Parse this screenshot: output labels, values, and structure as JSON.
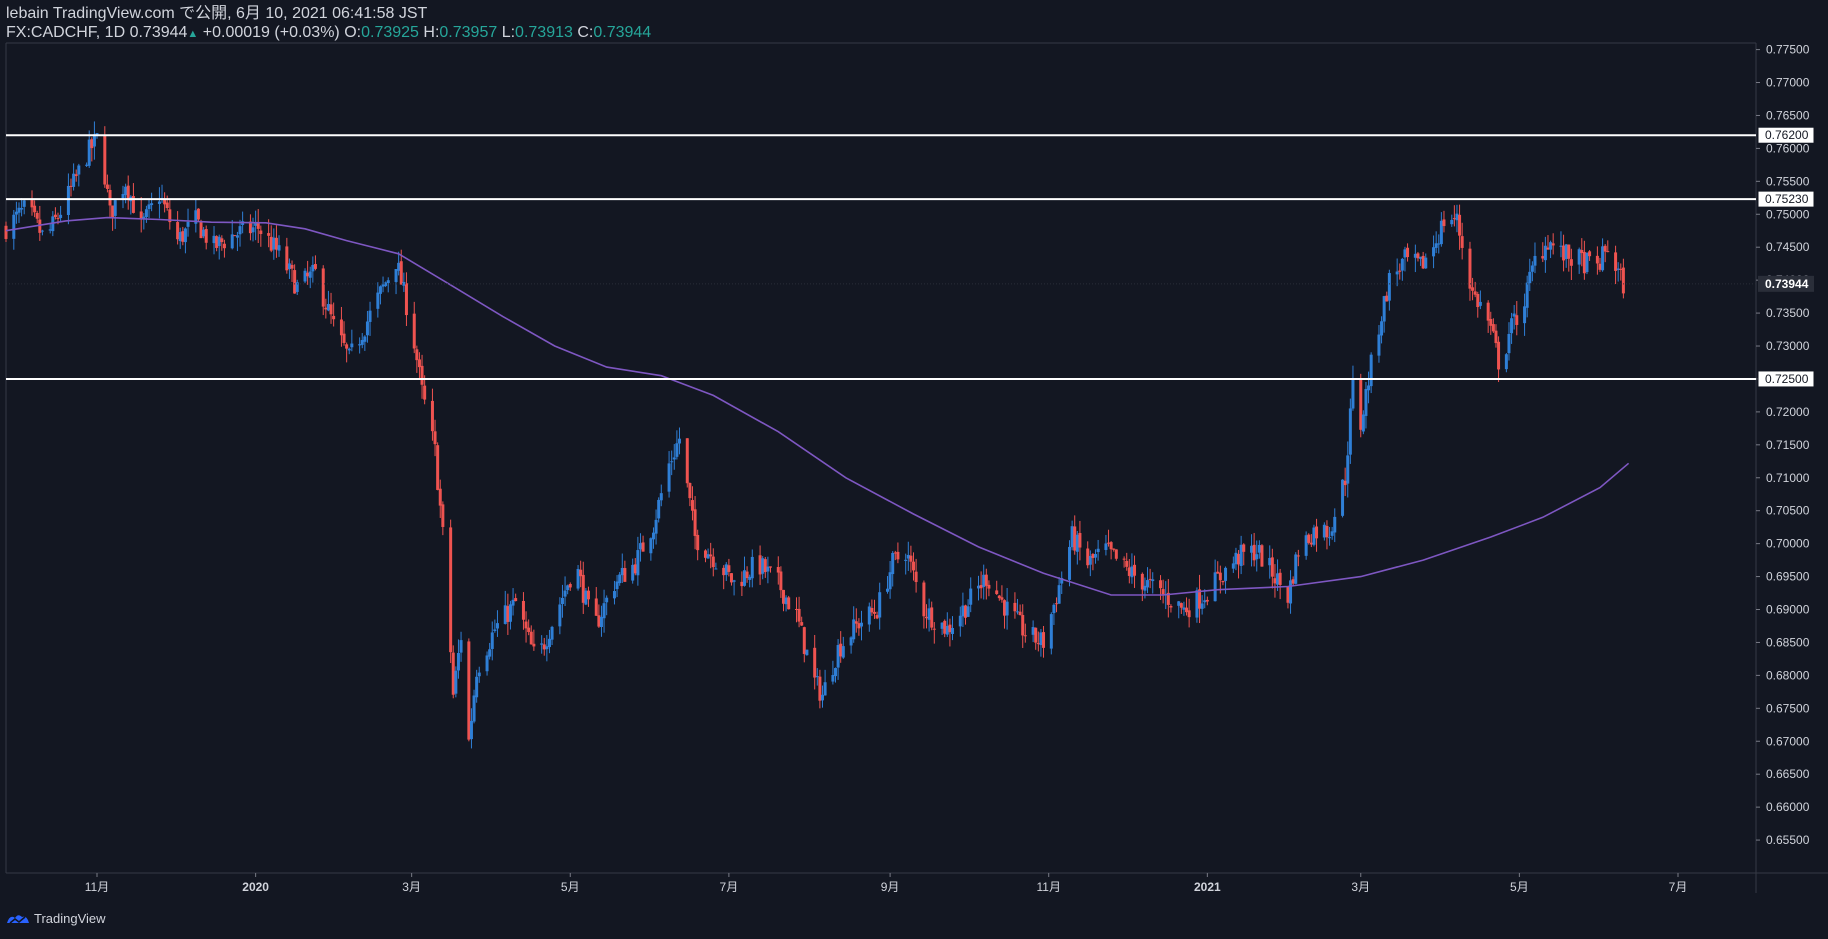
{
  "header": {
    "line1": "lebain TradingView.com で公開, 6月 10, 2021 06:41:58 JST",
    "symbol": "FX:CADCHF, 1D",
    "last": "0.73944",
    "change": "+0.00019 (+0.03%)",
    "o_label": "O:",
    "o_value": "0.73925",
    "h_label": "H:",
    "h_value": "0.73957",
    "l_label": "L:",
    "l_value": "0.73913",
    "c_label": "C:",
    "c_value": "0.73944"
  },
  "footer": {
    "brand": "TradingView",
    "icon": "tradingview-logo-icon"
  },
  "colors": {
    "background": "#131722",
    "up": "#2f7fd6",
    "down": "#ef5350",
    "ma": "#7e57c2",
    "level": "#ffffff",
    "text": "#d1d4dc",
    "ohlc_value": "#26a69a"
  },
  "chart_data": {
    "type": "candlestick",
    "symbol": "FX:CADCHF",
    "timeframe": "1D",
    "ylim": [
      0.65,
      0.776
    ],
    "y_ticks": [
      "0.77500",
      "0.77000",
      "0.76500",
      "0.76000",
      "0.75500",
      "0.75000",
      "0.74500",
      "0.74000",
      "0.73500",
      "0.73000",
      "0.72500",
      "0.72000",
      "0.71500",
      "0.71000",
      "0.70500",
      "0.70000",
      "0.69500",
      "0.69000",
      "0.68500",
      "0.68000",
      "0.67500",
      "0.67000",
      "0.66500",
      "0.66000",
      "0.65500"
    ],
    "x_range": [
      "2019-09-27",
      "2021-07-31"
    ],
    "x_ticks": [
      {
        "label": "11月",
        "date": "2019-11-01"
      },
      {
        "label": "2020",
        "date": "2020-01-01"
      },
      {
        "label": "3月",
        "date": "2020-03-01"
      },
      {
        "label": "5月",
        "date": "2020-05-01"
      },
      {
        "label": "7月",
        "date": "2020-07-01"
      },
      {
        "label": "9月",
        "date": "2020-09-01"
      },
      {
        "label": "11月",
        "date": "2020-11-01"
      },
      {
        "label": "2021",
        "date": "2021-01-01"
      },
      {
        "label": "3月",
        "date": "2021-03-01"
      },
      {
        "label": "5月",
        "date": "2021-05-01"
      },
      {
        "label": "7月",
        "date": "2021-07-01"
      }
    ],
    "horizontal_levels": [
      "0.76200",
      "0.75230",
      "0.72500"
    ],
    "last_price": "0.73944",
    "price_path": [
      [
        "2019-09-27",
        0.748
      ],
      [
        "2019-10-05",
        0.751
      ],
      [
        "2019-10-12",
        0.746
      ],
      [
        "2019-10-20",
        0.752
      ],
      [
        "2019-10-28",
        0.759
      ],
      [
        "2019-11-02",
        0.762
      ],
      [
        "2019-11-06",
        0.75
      ],
      [
        "2019-11-12",
        0.755
      ],
      [
        "2019-11-18",
        0.748
      ],
      [
        "2019-11-25",
        0.753
      ],
      [
        "2019-12-02",
        0.746
      ],
      [
        "2019-12-09",
        0.749
      ],
      [
        "2019-12-16",
        0.745
      ],
      [
        "2019-12-24",
        0.747
      ],
      [
        "2020-01-02",
        0.748
      ],
      [
        "2020-01-10",
        0.744
      ],
      [
        "2020-01-17",
        0.739
      ],
      [
        "2020-01-24",
        0.741
      ],
      [
        "2020-01-31",
        0.733
      ],
      [
        "2020-02-06",
        0.728
      ],
      [
        "2020-02-12",
        0.733
      ],
      [
        "2020-02-18",
        0.738
      ],
      [
        "2020-02-24",
        0.743
      ],
      [
        "2020-03-01",
        0.733
      ],
      [
        "2020-03-05",
        0.723
      ],
      [
        "2020-03-10",
        0.714
      ],
      [
        "2020-03-14",
        0.697
      ],
      [
        "2020-03-17",
        0.677
      ],
      [
        "2020-03-20",
        0.686
      ],
      [
        "2020-03-23",
        0.67
      ],
      [
        "2020-03-26",
        0.681
      ],
      [
        "2020-04-02",
        0.687
      ],
      [
        "2020-04-10",
        0.691
      ],
      [
        "2020-04-18",
        0.682
      ],
      [
        "2020-04-26",
        0.69
      ],
      [
        "2020-05-03",
        0.697
      ],
      [
        "2020-05-10",
        0.687
      ],
      [
        "2020-05-18",
        0.694
      ],
      [
        "2020-05-26",
        0.697
      ],
      [
        "2020-06-02",
        0.703
      ],
      [
        "2020-06-08",
        0.712
      ],
      [
        "2020-06-12",
        0.716
      ],
      [
        "2020-06-18",
        0.701
      ],
      [
        "2020-06-25",
        0.698
      ],
      [
        "2020-07-03",
        0.694
      ],
      [
        "2020-07-12",
        0.697
      ],
      [
        "2020-07-20",
        0.694
      ],
      [
        "2020-07-27",
        0.689
      ],
      [
        "2020-08-03",
        0.679
      ],
      [
        "2020-08-06",
        0.677
      ],
      [
        "2020-08-12",
        0.684
      ],
      [
        "2020-08-20",
        0.688
      ],
      [
        "2020-08-27",
        0.69
      ],
      [
        "2020-09-02",
        0.697
      ],
      [
        "2020-09-07",
        0.699
      ],
      [
        "2020-09-14",
        0.69
      ],
      [
        "2020-09-23",
        0.687
      ],
      [
        "2020-10-01",
        0.691
      ],
      [
        "2020-10-08",
        0.695
      ],
      [
        "2020-10-16",
        0.69
      ],
      [
        "2020-10-24",
        0.686
      ],
      [
        "2020-10-30",
        0.685
      ],
      [
        "2020-11-06",
        0.695
      ],
      [
        "2020-11-10",
        0.701
      ],
      [
        "2020-11-16",
        0.697
      ],
      [
        "2020-11-23",
        0.699
      ],
      [
        "2020-12-01",
        0.696
      ],
      [
        "2020-12-08",
        0.694
      ],
      [
        "2020-12-16",
        0.692
      ],
      [
        "2020-12-23",
        0.69
      ],
      [
        "2020-12-30",
        0.692
      ],
      [
        "2021-01-06",
        0.695
      ],
      [
        "2021-01-13",
        0.698
      ],
      [
        "2021-01-20",
        0.699
      ],
      [
        "2021-01-27",
        0.695
      ],
      [
        "2021-02-01",
        0.692
      ],
      [
        "2021-02-05",
        0.699
      ],
      [
        "2021-02-11",
        0.702
      ],
      [
        "2021-02-17",
        0.702
      ],
      [
        "2021-02-23",
        0.71
      ],
      [
        "2021-02-26",
        0.724
      ],
      [
        "2021-03-01",
        0.718
      ],
      [
        "2021-03-04",
        0.725
      ],
      [
        "2021-03-08",
        0.733
      ],
      [
        "2021-03-12",
        0.74
      ],
      [
        "2021-03-18",
        0.743
      ],
      [
        "2021-03-24",
        0.742
      ],
      [
        "2021-03-30",
        0.746
      ],
      [
        "2021-04-03",
        0.75
      ],
      [
        "2021-04-07",
        0.749
      ],
      [
        "2021-04-13",
        0.738
      ],
      [
        "2021-04-18",
        0.735
      ],
      [
        "2021-04-21",
        0.731
      ],
      [
        "2021-04-24",
        0.726
      ],
      [
        "2021-04-27",
        0.732
      ],
      [
        "2021-05-03",
        0.737
      ],
      [
        "2021-05-07",
        0.743
      ],
      [
        "2021-05-12",
        0.746
      ],
      [
        "2021-05-17",
        0.744
      ],
      [
        "2021-05-24",
        0.743
      ],
      [
        "2021-05-31",
        0.742
      ],
      [
        "2021-06-04",
        0.745
      ],
      [
        "2021-06-07",
        0.742
      ],
      [
        "2021-06-10",
        0.7394
      ]
    ],
    "moving_average": [
      [
        "2019-09-27",
        0.7475
      ],
      [
        "2019-10-20",
        0.749
      ],
      [
        "2019-11-05",
        0.7495
      ],
      [
        "2019-11-25",
        0.7492
      ],
      [
        "2019-12-15",
        0.7488
      ],
      [
        "2020-01-05",
        0.7487
      ],
      [
        "2020-01-20",
        0.7478
      ],
      [
        "2020-02-05",
        0.746
      ],
      [
        "2020-02-25",
        0.744
      ],
      [
        "2020-03-15",
        0.7395
      ],
      [
        "2020-04-05",
        0.7345
      ],
      [
        "2020-04-25",
        0.73
      ],
      [
        "2020-05-15",
        0.7268
      ],
      [
        "2020-06-05",
        0.7255
      ],
      [
        "2020-06-25",
        0.7225
      ],
      [
        "2020-07-20",
        0.717
      ],
      [
        "2020-08-15",
        0.71
      ],
      [
        "2020-09-10",
        0.7045
      ],
      [
        "2020-10-05",
        0.6995
      ],
      [
        "2020-10-30",
        0.6955
      ],
      [
        "2020-11-25",
        0.6922
      ],
      [
        "2020-12-15",
        0.6922
      ],
      [
        "2021-01-05",
        0.693
      ],
      [
        "2021-02-01",
        0.6935
      ],
      [
        "2021-03-01",
        0.695
      ],
      [
        "2021-03-25",
        0.6975
      ],
      [
        "2021-04-20",
        0.701
      ],
      [
        "2021-05-10",
        0.704
      ],
      [
        "2021-06-01",
        0.7085
      ],
      [
        "2021-06-12",
        0.7122
      ]
    ]
  }
}
